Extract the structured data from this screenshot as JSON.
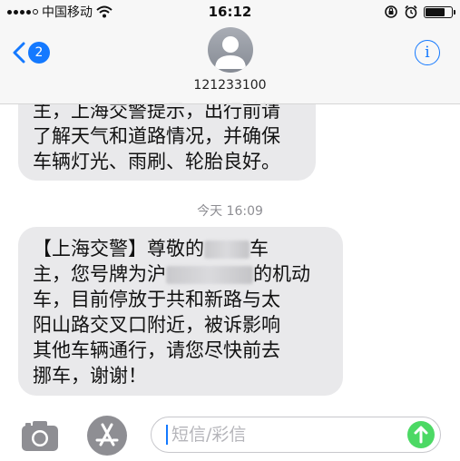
{
  "status_bar": {
    "carrier": "中国移动",
    "time": "16:12",
    "signal_bars": 4,
    "signal_total": 5,
    "battery_level": 0.8
  },
  "nav": {
    "back_badge": "2",
    "contact": "121233100",
    "info_label": "i"
  },
  "messages": {
    "first": {
      "lines": [
        "主，上海交警提示，出行前请",
        "了解天气和道路情况，并确保",
        "车辆灯光、雨刷、轮胎良好。"
      ]
    },
    "timestamp": "今天 16:09",
    "second": {
      "line1_a": "【上海交警】尊敬的",
      "line1_b": "车",
      "line2_a": "主，您号牌为沪",
      "line2_b": "的机动",
      "line3": "车，目前停放于共和新路与太",
      "line4": "阳山路交叉口附近，被诉影响",
      "line5": "其他车辆通行，请您尽快前去",
      "line6": "挪车，谢谢！"
    }
  },
  "input": {
    "placeholder": "短信/彩信"
  },
  "colors": {
    "accent": "#1479ff",
    "bubble": "#e9e9eb",
    "send": "#4cd964"
  }
}
